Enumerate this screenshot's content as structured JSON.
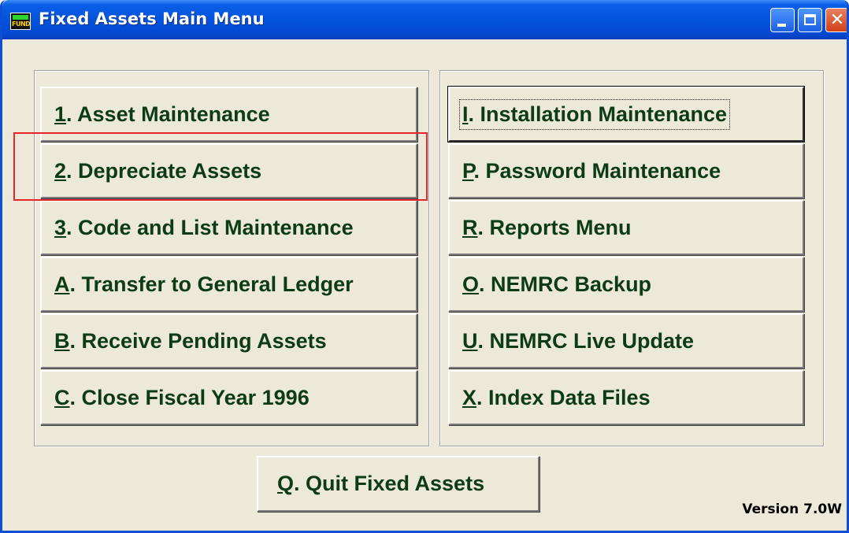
{
  "window": {
    "title": "Fixed Assets Main Menu",
    "icon_text": "FUND",
    "controls": [
      "minimize-icon",
      "maximize-icon",
      "close-icon"
    ]
  },
  "left_menu": [
    {
      "key": "1",
      "rest": ". Asset Maintenance"
    },
    {
      "key": "2",
      "rest": ". Depreciate Assets"
    },
    {
      "key": "3",
      "rest": ". Code and List Maintenance"
    },
    {
      "key": "A",
      "rest": ". Transfer to General Ledger"
    },
    {
      "key": "B",
      "rest": ". Receive Pending Assets"
    },
    {
      "key": "C",
      "rest": ". Close Fiscal Year 1996"
    }
  ],
  "right_menu": [
    {
      "key": "I",
      "rest": ". Installation Maintenance"
    },
    {
      "key": "P",
      "rest": ". Password Maintenance"
    },
    {
      "key": "R",
      "rest": ". Reports Menu"
    },
    {
      "key": "O",
      "rest": ". NEMRC Backup"
    },
    {
      "key": "U",
      "rest": ". NEMRC Live Update"
    },
    {
      "key": "X",
      "rest": ". Index Data Files"
    }
  ],
  "quit": {
    "key": "Q",
    "rest": ". Quit Fixed Assets"
  },
  "version": "Version 7.0W",
  "colors": {
    "title_bar": "#0453dc",
    "button_text": "#0c3b14",
    "highlight": "#e8262a",
    "window_bg": "#ece9d8"
  }
}
